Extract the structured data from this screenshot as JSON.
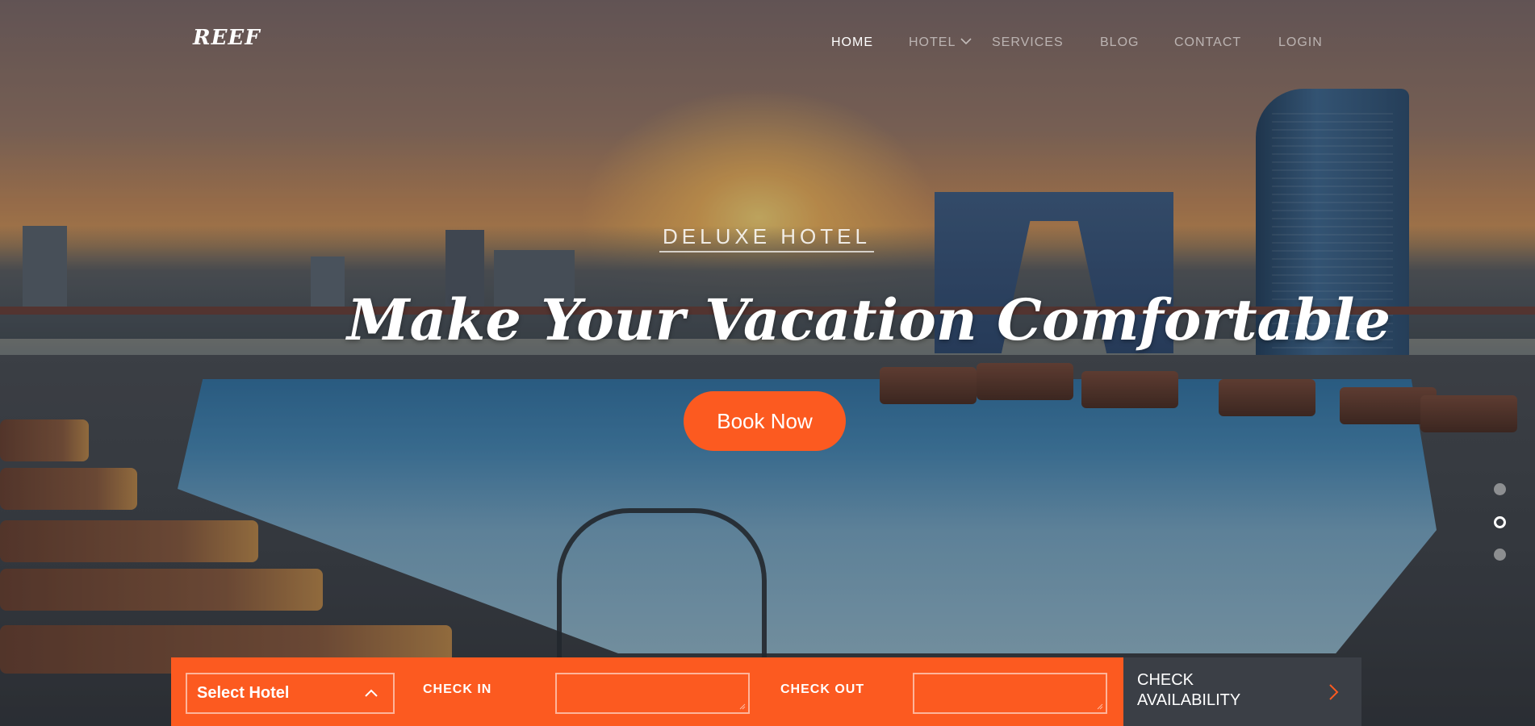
{
  "brand": {
    "logo": "REEF"
  },
  "nav": {
    "items": [
      {
        "label": "HOME",
        "active": true
      },
      {
        "label": "HOTEL",
        "active": false,
        "has_dropdown": true
      },
      {
        "label": "SERVICES",
        "active": false
      },
      {
        "label": "BLOG",
        "active": false
      },
      {
        "label": "CONTACT",
        "active": false
      },
      {
        "label": "LOGIN",
        "active": false
      }
    ]
  },
  "hero": {
    "subtitle": "DELUXE HOTEL",
    "headline": "Make Your Vacation Comfortable",
    "cta_label": "Book Now"
  },
  "slider": {
    "dot_count": 3,
    "active_index": 1
  },
  "booking": {
    "select_hotel": {
      "value": "Select Hotel",
      "icon": "chevron-up-icon"
    },
    "check_in": {
      "label": "CHECK IN",
      "value": ""
    },
    "check_out": {
      "label": "CHECK OUT",
      "value": ""
    },
    "check_availability": {
      "label": "CHECK AVAILABILITY",
      "icon": "chevron-right-icon"
    }
  },
  "colors": {
    "accent": "#fc5a20",
    "check_button_bg": "#3b3f46",
    "text_light": "#ffffff"
  }
}
